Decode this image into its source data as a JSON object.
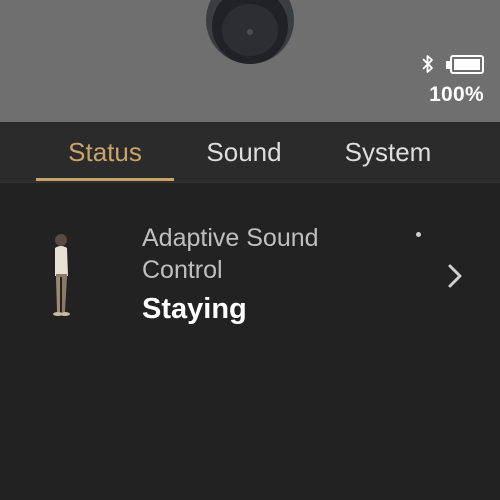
{
  "header": {
    "device_image": "earbud-image",
    "bluetooth_icon": "bluetooth-icon",
    "battery_icon": "battery-icon",
    "battery_level": 1.0,
    "battery_text": "100%"
  },
  "tabs": [
    {
      "label": "Status",
      "active": true
    },
    {
      "label": "Sound",
      "active": false
    },
    {
      "label": "System",
      "active": false
    }
  ],
  "status": {
    "adaptive": {
      "title": "Adaptive Sound Control",
      "value": "Staying",
      "illustration": "standing-person-icon",
      "chevron": "chevron-right-icon"
    }
  },
  "colors": {
    "header_bg": "#6f6f6f",
    "body_bg": "#222222",
    "accent": "#c8a468"
  }
}
